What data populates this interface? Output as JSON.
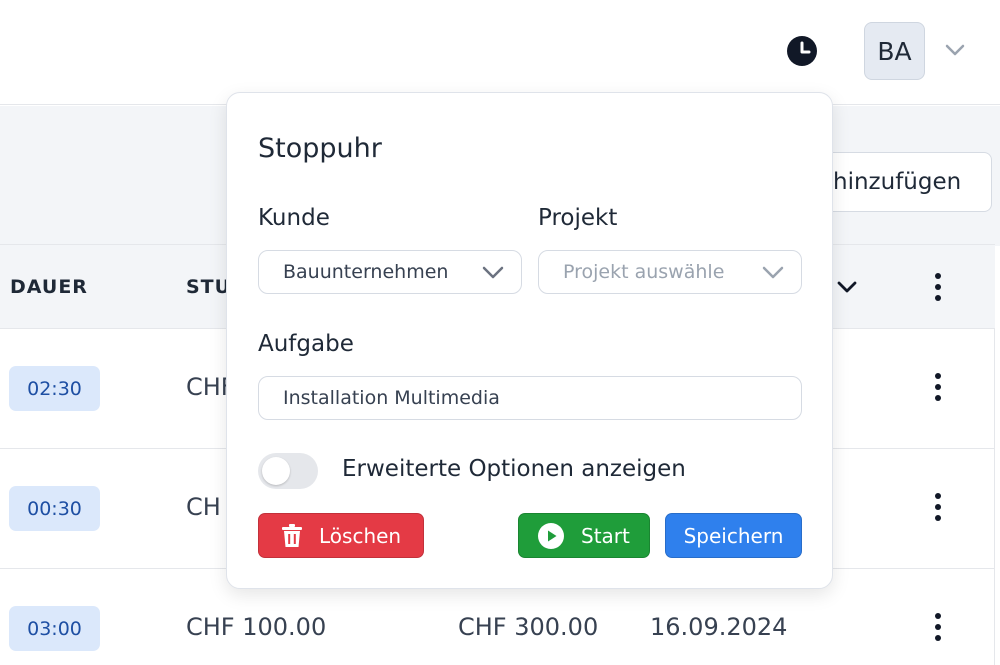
{
  "header": {
    "avatar_initials": "BA"
  },
  "toolbar": {
    "add_label": "hinzufügen"
  },
  "table": {
    "columns": [
      "DAUER",
      "STU"
    ],
    "rows": [
      {
        "duration": "02:30",
        "rate": "CHF",
        "total": "",
        "date": ""
      },
      {
        "duration": "00:30",
        "rate": "CH",
        "total": "",
        "date": ""
      },
      {
        "duration": "03:00",
        "rate": "CHF 100.00",
        "total": "CHF 300.00",
        "date": "16.09.2024"
      }
    ]
  },
  "popup": {
    "title": "Stoppuhr",
    "customer_label": "Kunde",
    "customer_value": "Bauunternehmen",
    "project_label": "Projekt",
    "project_placeholder": "Projekt auswähle",
    "task_label": "Aufgabe",
    "task_value": "Installation Multimedia",
    "toggle_label": "Erweiterte Optionen anzeigen",
    "toggle_on": false,
    "delete_label": "Löschen",
    "start_label": "Start",
    "save_label": "Speichern"
  },
  "colors": {
    "delete": "#e43a45",
    "start": "#1f9d3a",
    "save": "#2f80ed",
    "duration_badge": "#dbe8fb"
  },
  "icons": [
    "clock-icon",
    "chevron-down-icon",
    "kebab-menu-icon",
    "trash-icon",
    "play-icon"
  ]
}
